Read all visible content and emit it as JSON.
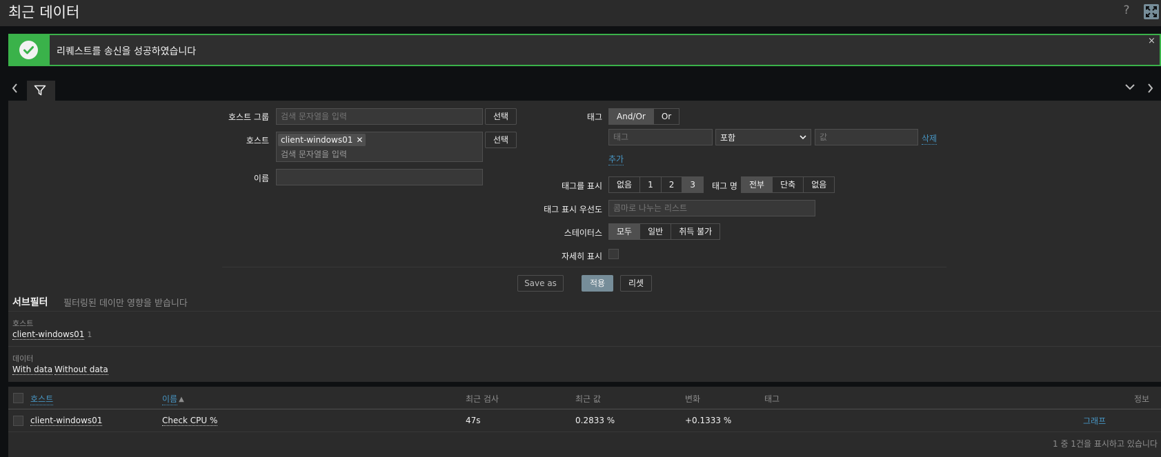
{
  "header": {
    "title": "최근 데이터",
    "help_icon": "?"
  },
  "message": {
    "text": "리퀘스트를 송신을 성공하였습니다",
    "close": "×",
    "status_color": "#3ab24a"
  },
  "filter": {
    "host_group": {
      "label": "호스트 그룹",
      "placeholder": "검색 문자열을 입력",
      "select_label": "선택"
    },
    "host": {
      "label": "호스트",
      "chip": "client-windows01",
      "chip_remove": "✕",
      "placeholder": "검색 문자열을 입력",
      "select_label": "선택"
    },
    "name": {
      "label": "이름",
      "value": ""
    },
    "tags": {
      "label": "태그",
      "operator_options": [
        "And/Or",
        "Or"
      ],
      "operator_selected": "And/Or",
      "tag_placeholder": "태그",
      "condition": "포함",
      "value_placeholder": "값",
      "remove_label": "삭제",
      "add_label": "추가"
    },
    "show_tags": {
      "label": "태그를 표시",
      "options": [
        "없음",
        "1",
        "2",
        "3"
      ],
      "selected": "3"
    },
    "tag_name": {
      "label": "태그 명",
      "options": [
        "전부",
        "단축",
        "없음"
      ],
      "selected": "전부"
    },
    "tag_priority": {
      "label": "태그 표시 우선도",
      "placeholder": "콤마로 나누는 리스트"
    },
    "state": {
      "label": "스테이터스",
      "options": [
        "모두",
        "일반",
        "취득 불가"
      ],
      "selected": "모두"
    },
    "details": {
      "label": "자세히 표시"
    },
    "buttons": {
      "save_as": "Save as",
      "apply": "적용",
      "reset": "리셋"
    }
  },
  "subfilter": {
    "title": "서브필터",
    "note": "필터링된 데이만 영향을 받습니다",
    "hosts": {
      "label": "호스트",
      "items": [
        {
          "name": "client-windows01",
          "count": "1"
        }
      ]
    },
    "data": {
      "label": "데이터",
      "items": [
        "With data",
        "Without data"
      ]
    }
  },
  "table": {
    "columns": {
      "host": "호스트",
      "name": "이름",
      "sort_indicator": "▲",
      "last_check": "최근 검사",
      "last_value": "최근 값",
      "change": "변화",
      "tags": "태그",
      "info": "정보"
    },
    "rows": [
      {
        "host": "client-windows01",
        "name": "Check CPU %",
        "last_check": "47s",
        "last_value": "0.2833 %",
        "change": "+0.1333 %",
        "action": "그래프"
      }
    ],
    "footer": "1 중 1건을 표시하고 있습니다"
  }
}
